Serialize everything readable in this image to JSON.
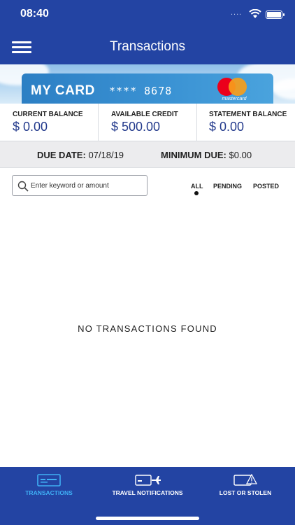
{
  "status_bar": {
    "time": "08:40",
    "signal": "...."
  },
  "nav": {
    "title": "Transactions",
    "menu_icon": "hamburger-menu-icon"
  },
  "card": {
    "title": "MY CARD",
    "number": "**** 8678",
    "brand": "mastercard"
  },
  "balances": [
    {
      "label": "CURRENT BALANCE",
      "value": "$ 0.00"
    },
    {
      "label": "AVAILABLE CREDIT",
      "value": "$ 500.00"
    },
    {
      "label": "STATEMENT BALANCE",
      "value": "$ 0.00"
    }
  ],
  "due": {
    "due_date_label": "DUE DATE:",
    "due_date_value": "07/18/19",
    "min_due_label": "MINIMUM DUE:",
    "min_due_value": "$0.00"
  },
  "search": {
    "placeholder": "Enter keyword or amount",
    "icon": "search-icon"
  },
  "filters": {
    "all": "ALL",
    "pending": "PENDING",
    "posted": "POSTED",
    "selected": "ALL"
  },
  "empty_message": "NO TRANSACTIONS FOUND",
  "tab_bar": {
    "tabs": [
      {
        "label": "TRANSACTIONS",
        "icon": "card-icon",
        "active": true
      },
      {
        "label": "TRAVEL NOTIFICATIONS",
        "icon": "card-airplane-icon",
        "active": false
      },
      {
        "label": "LOST OR STOLEN",
        "icon": "card-warning-icon",
        "active": false
      }
    ]
  },
  "colors": {
    "primary": "#2344a3",
    "accent": "#3fb0f5",
    "value_text": "#233a8c"
  }
}
